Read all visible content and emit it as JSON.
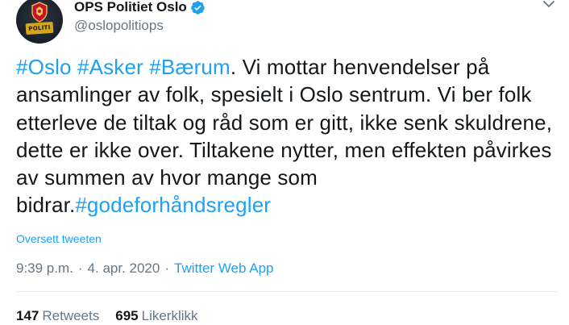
{
  "account": {
    "display_name": "OPS Politiet Oslo",
    "handle": "@oslopolitiops",
    "avatar_patch_text": "POLITI",
    "verified": true
  },
  "tweet": {
    "segments": [
      {
        "text": "#Oslo",
        "type": "hashtag"
      },
      {
        "text": " ",
        "type": "text"
      },
      {
        "text": "#Asker",
        "type": "hashtag"
      },
      {
        "text": " ",
        "type": "text"
      },
      {
        "text": "#Bærum",
        "type": "hashtag"
      },
      {
        "text": ". Vi mottar henvendelser på ansamlinger av folk, spesielt i Oslo sentrum. Vi ber folk etterleve de tiltak og råd som er gitt, ikke senk skuldrene, dette er ikke over. Tiltakene nytter, men effekten påvirkes av summen av hvor mange som bidrar.",
        "type": "text"
      },
      {
        "text": "#godeforhåndsregler",
        "type": "hashtag"
      }
    ],
    "translate_label": "Oversett tweeten",
    "time": "9:39 p.m.",
    "separator": "·",
    "date": "4. apr. 2020",
    "source": "Twitter Web App"
  },
  "stats": {
    "retweets_count": "147",
    "retweets_label": "Retweets",
    "likes_count": "695",
    "likes_label": "Likerklikk"
  },
  "icons": {
    "verified": "verified-badge-icon",
    "caret": "chevron-down-icon",
    "emblem": "police-emblem-icon"
  },
  "colors": {
    "link": "#1da1f2",
    "text": "#14171a",
    "secondary": "#657786",
    "divider": "#e6ecf0",
    "avatar_bg": "#1a2029",
    "patch": "#d4a51c"
  }
}
